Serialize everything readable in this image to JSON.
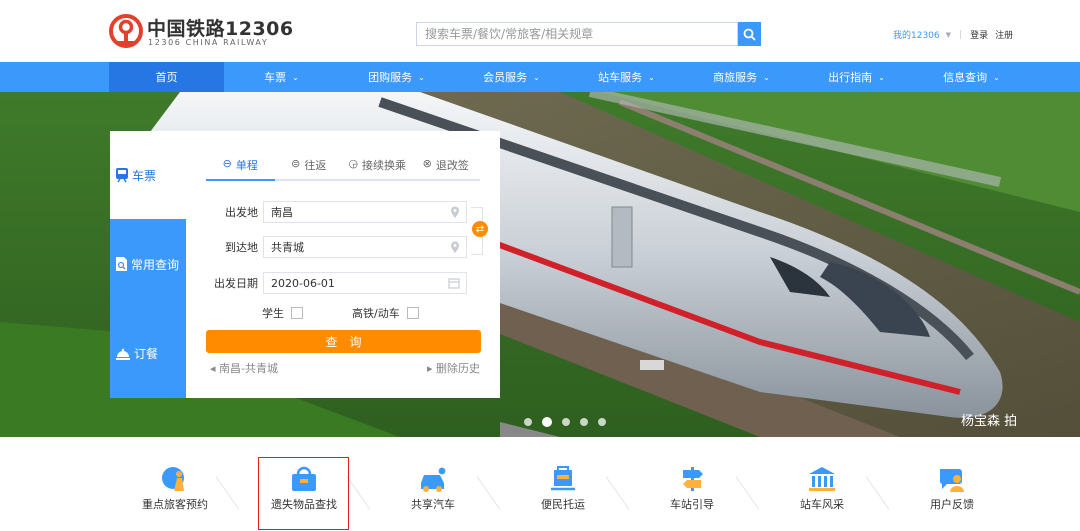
{
  "header": {
    "logo_cn": "中国铁路12306",
    "logo_en": "12306 CHINA RAILWAY",
    "search_placeholder": "搜索车票/餐饮/常旅客/相关规章",
    "my_account": "我的12306",
    "login": "登录",
    "register": "注册"
  },
  "nav": {
    "items": [
      {
        "label": "首页",
        "dropdown": false
      },
      {
        "label": "车票",
        "dropdown": true
      },
      {
        "label": "团购服务",
        "dropdown": true
      },
      {
        "label": "会员服务",
        "dropdown": true
      },
      {
        "label": "站车服务",
        "dropdown": true
      },
      {
        "label": "商旅服务",
        "dropdown": true
      },
      {
        "label": "出行指南",
        "dropdown": true
      },
      {
        "label": "信息查询",
        "dropdown": true
      }
    ]
  },
  "booking": {
    "side_tabs": [
      "车票",
      "常用查询",
      "订餐"
    ],
    "trip_tabs": [
      {
        "label": "单程",
        "icon": "⊖"
      },
      {
        "label": "往返",
        "icon": "⊜"
      },
      {
        "label": "接续换乘",
        "icon": "◶"
      },
      {
        "label": "退改签",
        "icon": "⊗"
      }
    ],
    "from_label": "出发地",
    "from_value": "南昌",
    "to_label": "到达地",
    "to_value": "共青城",
    "date_label": "出发日期",
    "date_value": "2020-06-01",
    "student_label": "学生",
    "highspeed_label": "高铁/动车",
    "query_button": "查询",
    "history_item": "南昌-共青城",
    "clear_history": "删除历史"
  },
  "banner": {
    "credit": "杨宝森 拍"
  },
  "services": [
    {
      "label": "重点旅客预约",
      "icon": "key-passenger-icon"
    },
    {
      "label": "遗失物品查找",
      "icon": "lost-found-icon"
    },
    {
      "label": "共享汽车",
      "icon": "shared-car-icon"
    },
    {
      "label": "便民托运",
      "icon": "consignment-icon"
    },
    {
      "label": "车站引导",
      "icon": "station-guide-icon"
    },
    {
      "label": "站车风采",
      "icon": "station-style-icon"
    },
    {
      "label": "用户反馈",
      "icon": "feedback-icon"
    }
  ],
  "colors": {
    "primary": "#3b99fc",
    "nav_active": "#2676e3",
    "accent_orange": "#ff8c00",
    "logo_red": "#e2412e",
    "highlight_red": "#e02020"
  }
}
